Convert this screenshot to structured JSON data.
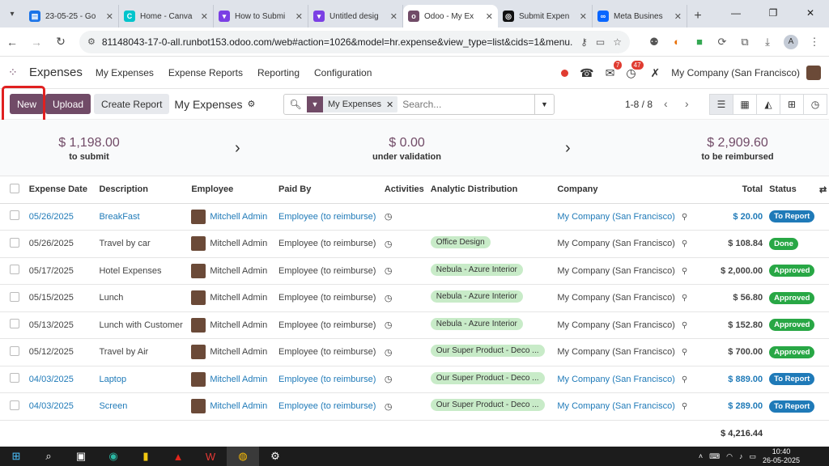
{
  "browser": {
    "tabs": [
      {
        "title": "23-05-25 - Go",
        "color": "#1a73e8",
        "glyph": "▤"
      },
      {
        "title": "Home - Canva",
        "color": "#00c4cc",
        "glyph": "C"
      },
      {
        "title": "How to Submi",
        "color": "#7b3fe4",
        "glyph": "▾"
      },
      {
        "title": "Untitled desig",
        "color": "#7b3fe4",
        "glyph": "▾"
      },
      {
        "title": "Odoo - My Ex",
        "color": "#714b67",
        "glyph": "o",
        "active": true
      },
      {
        "title": "Submit Expen",
        "color": "#111111",
        "glyph": "◎"
      },
      {
        "title": "Meta Busines",
        "color": "#0866ff",
        "glyph": "∞"
      }
    ],
    "url": "81148043-17-0-all.runbot153.odoo.com/web#action=1026&model=hr.expense&view_type=list&cids=1&menu...",
    "profile_initial": "A"
  },
  "navbar": {
    "app_name": "Expenses",
    "menus": [
      "My Expenses",
      "Expense Reports",
      "Reporting",
      "Configuration"
    ],
    "messages_count": "7",
    "activities_count": "47",
    "company": "My Company (San Francisco)"
  },
  "control_panel": {
    "new_label": "New",
    "upload_label": "Upload",
    "create_report_label": "Create Report",
    "title": "My Expenses",
    "facet_label": "My Expenses",
    "search_placeholder": "Search...",
    "pager": "1-8 / 8"
  },
  "summary": {
    "to_submit": {
      "amount": "$ 1,198.00",
      "label": "to submit"
    },
    "under_validation": {
      "amount": "$ 0.00",
      "label": "under validation"
    },
    "to_be_reimbursed": {
      "amount": "$ 2,909.60",
      "label": "to be reimbursed"
    }
  },
  "table": {
    "columns": {
      "date": "Expense Date",
      "description": "Description",
      "employee": "Employee",
      "paid_by": "Paid By",
      "activities": "Activities",
      "analytic": "Analytic Distribution",
      "company": "Company",
      "total": "Total",
      "status": "Status"
    },
    "rows": [
      {
        "date": "05/26/2025",
        "description": "BreakFast",
        "employee": "Mitchell Admin",
        "paid_by": "Employee (to reimburse)",
        "analytic": "",
        "company": "My Company (San Francisco)",
        "total": "$ 20.00",
        "status": "To Report"
      },
      {
        "date": "05/26/2025",
        "description": "Travel by car",
        "employee": "Mitchell Admin",
        "paid_by": "Employee (to reimburse)",
        "analytic": "Office Design",
        "company": "My Company (San Francisco)",
        "total": "$ 108.84",
        "status": "Done"
      },
      {
        "date": "05/17/2025",
        "description": "Hotel Expenses",
        "employee": "Mitchell Admin",
        "paid_by": "Employee (to reimburse)",
        "analytic": "Nebula - Azure Interior",
        "company": "My Company (San Francisco)",
        "total": "$ 2,000.00",
        "status": "Approved"
      },
      {
        "date": "05/15/2025",
        "description": "Lunch",
        "employee": "Mitchell Admin",
        "paid_by": "Employee (to reimburse)",
        "analytic": "Nebula - Azure Interior",
        "company": "My Company (San Francisco)",
        "total": "$ 56.80",
        "status": "Approved"
      },
      {
        "date": "05/13/2025",
        "description": "Lunch with Customer",
        "employee": "Mitchell Admin",
        "paid_by": "Employee (to reimburse)",
        "analytic": "Nebula - Azure Interior",
        "company": "My Company (San Francisco)",
        "total": "$ 152.80",
        "status": "Approved"
      },
      {
        "date": "05/12/2025",
        "description": "Travel by Air",
        "employee": "Mitchell Admin",
        "paid_by": "Employee (to reimburse)",
        "analytic": "Our Super Product - Deco ...",
        "company": "My Company (San Francisco)",
        "total": "$ 700.00",
        "status": "Approved"
      },
      {
        "date": "04/03/2025",
        "description": "Laptop",
        "employee": "Mitchell Admin",
        "paid_by": "Employee (to reimburse)",
        "analytic": "Our Super Product - Deco ...",
        "company": "My Company (San Francisco)",
        "total": "$ 889.00",
        "status": "To Report"
      },
      {
        "date": "04/03/2025",
        "description": "Screen",
        "employee": "Mitchell Admin",
        "paid_by": "Employee (to reimburse)",
        "analytic": "Our Super Product - Deco ...",
        "company": "My Company (San Francisco)",
        "total": "$ 289.00",
        "status": "To Report"
      }
    ],
    "grand_total": "$ 4,216.44"
  },
  "taskbar": {
    "time": "10:40",
    "date": "26-05-2025"
  },
  "colors": {
    "brand": "#714b67",
    "link": "#1f7ab8",
    "success": "#28a745",
    "highlight_border": "#e02020"
  }
}
